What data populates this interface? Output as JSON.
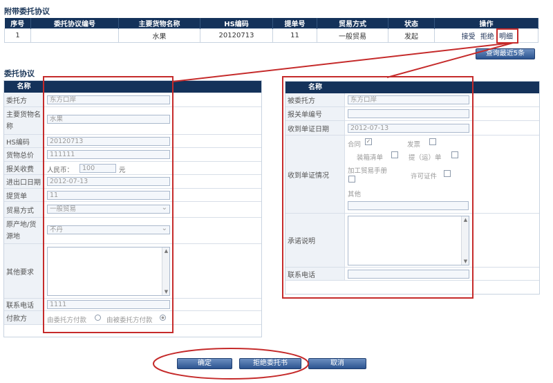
{
  "attached": {
    "title": "附带委托协议",
    "headers": [
      "序号",
      "委托协议编号",
      "主要货物名称",
      "HS编码",
      "提单号",
      "贸易方式",
      "状态",
      "操作"
    ],
    "row": {
      "no": "1",
      "agreement_no": "",
      "goods": "水果",
      "hs": "20120713",
      "bill": "11",
      "trade": "一般贸易",
      "status": "发起"
    },
    "ops": [
      "接受",
      "拒绝",
      "明细"
    ],
    "query_button": "查询最近5条"
  },
  "left": {
    "title": "委托协议",
    "header": "名称",
    "fields": {
      "client_label": "委托方",
      "client": "东方口岸",
      "goods_label": "主要货物名称",
      "goods": "水果",
      "hs_label": "HS编码",
      "hs": "20120713",
      "total_label": "货物总价",
      "total": "111111",
      "fee_label": "报关收费",
      "fee_prefix": "人民币：",
      "fee": "100",
      "fee_unit": "元",
      "date_label": "进出口日期",
      "date": "2012-07-13",
      "bill_label": "提货单",
      "bill": "11",
      "trade_label": "贸易方式",
      "trade": "一般贸易",
      "origin_label": "原产地/货源地",
      "origin": "不丹",
      "other_label": "其他要求",
      "phone_label": "联系电话",
      "phone": "1111",
      "payer_label": "付款方",
      "payer_opt1": "由委托方付款",
      "payer_opt2": "由被委托方付款"
    }
  },
  "right": {
    "header": "名称",
    "fields": {
      "agent_label": "被委托方",
      "agent": "东方口岸",
      "decl_label": "报关单编号",
      "decl": "",
      "recv_date_label": "收到单证日期",
      "recv_date": "2012-07-13",
      "docs_label": "收到单证情况",
      "cb_contract": "合同",
      "cb_invoice": "发票",
      "cb_packing": "装箱清单",
      "cb_lading": "提（运）单",
      "cb_manual": "加工贸易手册",
      "cb_license": "许可证件",
      "cb_other": "其他",
      "promise_label": "承诺说明",
      "phone_label": "联系电话"
    }
  },
  "buttons": {
    "confirm": "确定",
    "reject": "拒绝委托书",
    "cancel": "取消"
  },
  "colors": {
    "header": "#14325a",
    "annotation": "#c52a2a"
  }
}
